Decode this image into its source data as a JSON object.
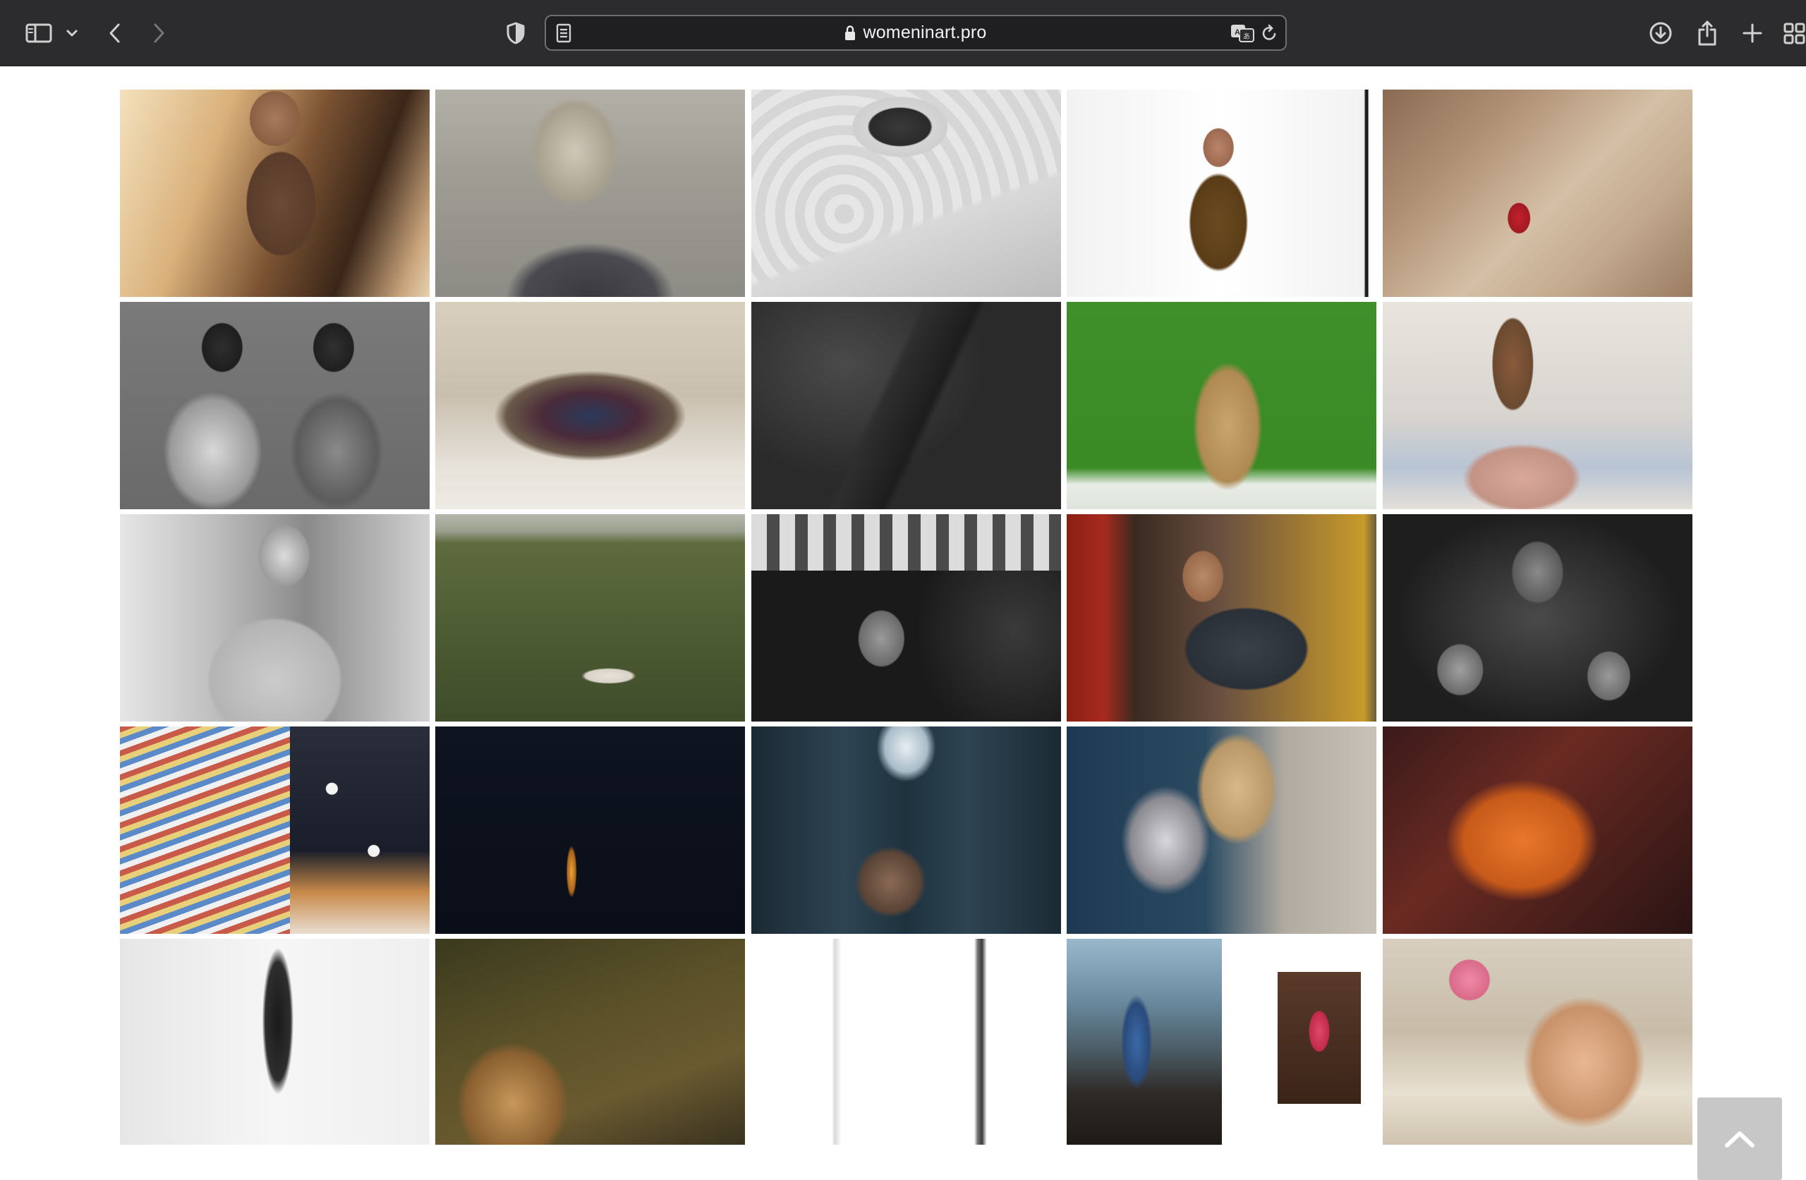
{
  "browser": {
    "url": "womeninart.pro"
  },
  "gallery": {
    "photos": [
      {
        "subject": "woman in tank top sitting by sunlit window"
      },
      {
        "subject": "faded portrait with textured overlay"
      },
      {
        "subject": "hand holding mirror against floral wallpaper"
      },
      {
        "subject": "woman in brown tank top against white wall"
      },
      {
        "subject": "child in red walking on rocky steps"
      },
      {
        "subject": "two women seated, black and white"
      },
      {
        "subject": "pile of clothes with person lying"
      },
      {
        "subject": "figure underwater, dark"
      },
      {
        "subject": "nude figure on green background"
      },
      {
        "subject": "double exposure of room interior"
      },
      {
        "subject": "figure with foil covering face"
      },
      {
        "subject": "woman lying in grassy field"
      },
      {
        "subject": "stone balustrade with carved face and leaves"
      },
      {
        "subject": "man crouching in workshop"
      },
      {
        "subject": "woman and children with foliage"
      },
      {
        "subject": "striped and dotted socks with sandals"
      },
      {
        "subject": "dark night scene with small light"
      },
      {
        "subject": "figure seated before curtain"
      },
      {
        "subject": "woman with silver sculpture"
      },
      {
        "subject": "hand holding cut-out photos"
      },
      {
        "subject": "white wall with dark opening and hand"
      },
      {
        "subject": "woman before tapestry painting"
      },
      {
        "subject": "minimal white form outline"
      },
      {
        "subject": "woman on rocky shore beside print"
      },
      {
        "subject": "young woman with pink flowers at table"
      }
    ]
  },
  "colors": {
    "toolbar": "#2c2c2e",
    "back_to_top": "#c7c7c7"
  }
}
